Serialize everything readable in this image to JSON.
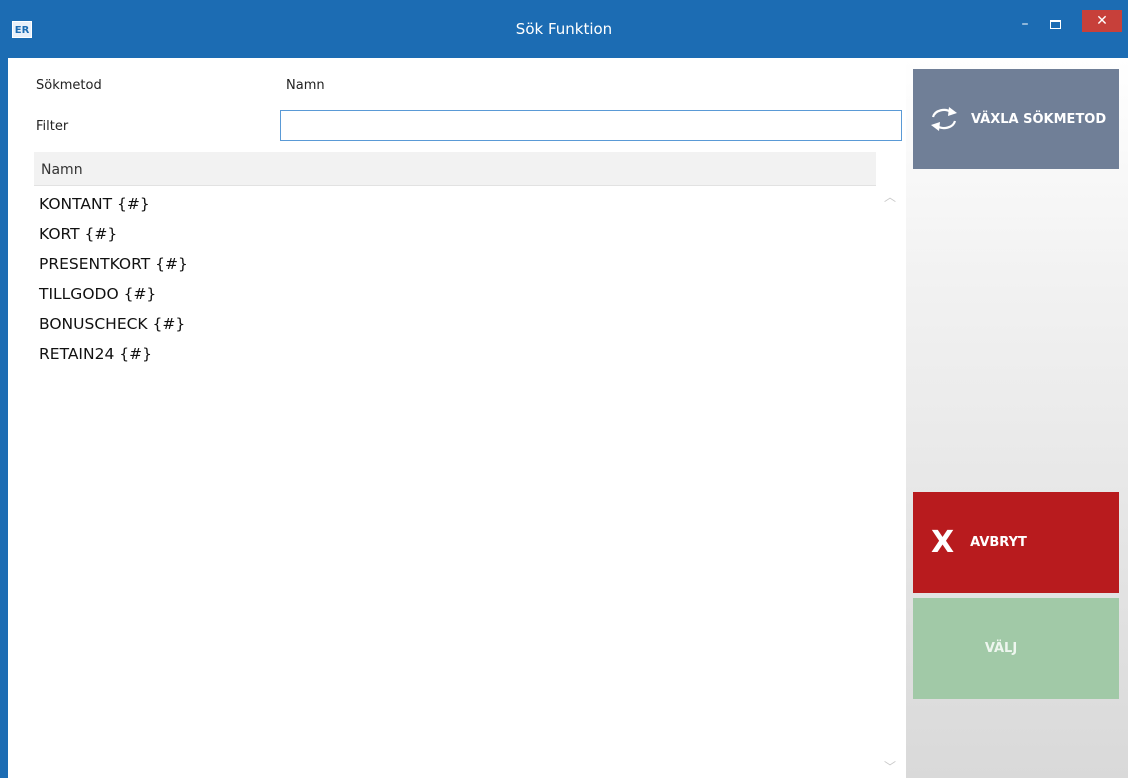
{
  "window": {
    "app_icon": "ER",
    "title": "Sök Funktion",
    "minimize": "–",
    "close": "✕"
  },
  "form": {
    "method_label": "Sökmetod",
    "method_value": "Namn",
    "filter_label": "Filter",
    "filter_value": "",
    "filter_placeholder": ""
  },
  "grid": {
    "column_header": "Namn",
    "rows": [
      "KONTANT {#}",
      "KORT {#}",
      "PRESENTKORT {#}",
      "TILLGODO {#}",
      "BONUSCHECK {#}",
      "RETAIN24 {#}"
    ],
    "scroll_up": "︿",
    "scroll_down": "﹀"
  },
  "buttons": {
    "switch_method": "VÄXLA SÖKMETOD",
    "switch_icon": "swap-arrows-icon",
    "cancel": "AVBRYT",
    "cancel_icon": "x-icon",
    "cancel_glyph": "X",
    "select": "VÄLJ"
  },
  "colors": {
    "titlebar": "#1c6cb3",
    "switch_button": "#707f97",
    "cancel_button": "#b81b1e",
    "select_button": "#a1c9a7"
  }
}
